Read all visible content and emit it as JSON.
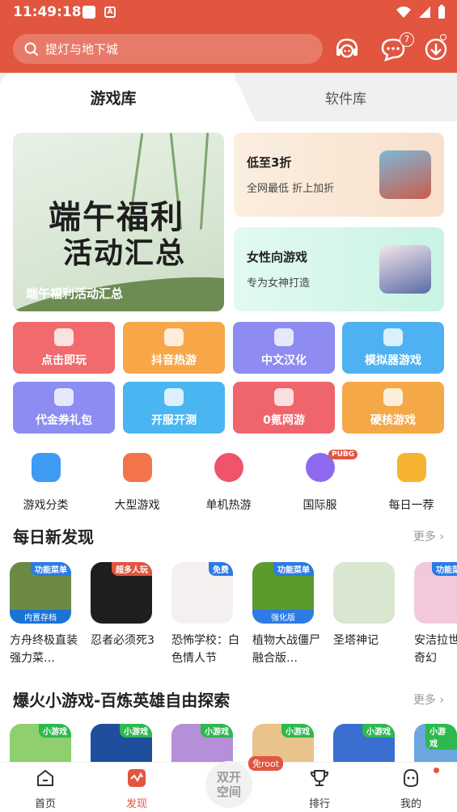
{
  "status": {
    "time": "11:49:18"
  },
  "header": {
    "search_placeholder": "提灯与地下城",
    "message_count": "7"
  },
  "tabs": [
    "游戏库",
    "软件库"
  ],
  "banner": {
    "art_line1": "端午福利",
    "art_line2": "活动汇总",
    "caption": "端午福利活动汇总"
  },
  "promo_cards": [
    {
      "title": "低至3折",
      "subtitle": "全网最低 折上加折",
      "color": "#FBE9D6"
    },
    {
      "title": "女性向游戏",
      "subtitle": "专为女神打造",
      "color": "#D7F6EA"
    }
  ],
  "grid_buttons": [
    {
      "label": "点击即玩",
      "color": "#F06A6E"
    },
    {
      "label": "抖音热游",
      "color": "#F7A748"
    },
    {
      "label": "中文汉化",
      "color": "#8E8CF0"
    },
    {
      "label": "模拟器游戏",
      "color": "#4EB2F2"
    },
    {
      "label": "代金券礼包",
      "color": "#8C8CF2"
    },
    {
      "label": "开服开测",
      "color": "#49B6F1"
    },
    {
      "label": "0氪网游",
      "color": "#F0656C"
    },
    {
      "label": "硬核游戏",
      "color": "#F5A847"
    }
  ],
  "quick_links": [
    {
      "label": "游戏分类",
      "icon": "category-icon",
      "color": "#3D9BF3"
    },
    {
      "label": "大型游戏",
      "icon": "gamepad-icon",
      "color": "#F3744A"
    },
    {
      "label": "单机热游",
      "icon": "pacman-icon",
      "color": "#F0536A"
    },
    {
      "label": "国际服",
      "icon": "globe-icon",
      "color": "#8E6AF0",
      "badge": "PUBG"
    },
    {
      "label": "每日一荐",
      "icon": "star-badge-icon",
      "color": "#F6B332"
    }
  ],
  "section1": {
    "title": "每日新发现",
    "more": "更多",
    "apps": [
      {
        "name": "方舟终极直装强力菜…",
        "tag": "功能菜单",
        "subtag": "内置存档",
        "tag_color": "#2d7be5",
        "color": "#6c8a43"
      },
      {
        "name": "忍者必须死3",
        "tag": "超多人玩",
        "tag_color": "#E2553F",
        "color": "#1e1e1e"
      },
      {
        "name": "恐怖学校：白色情人节",
        "tag": "免费",
        "tag_color": "#2d7be5",
        "color": "#f4f0f0"
      },
      {
        "name": "植物大战僵尸融合版…",
        "tag": "功能菜单",
        "subtag": "强化版",
        "tag_color": "#2d7be5",
        "color": "#5b9a2c"
      },
      {
        "name": "圣塔神记",
        "tag": "",
        "tag_color": "#2d7be5",
        "color": "#d9e6d0"
      },
      {
        "name": "安洁拉世界：奇幻",
        "tag": "功能菜单",
        "tag_color": "#2d7be5",
        "color": "#f3c8dd"
      }
    ]
  },
  "section2": {
    "title": "爆火小游戏-百炼英雄自由探索",
    "more": "更多",
    "apps": [
      {
        "tag": "小游戏",
        "color": "#8fcf6e"
      },
      {
        "tag": "小游戏",
        "color": "#1f4f9c"
      },
      {
        "tag": "小游戏",
        "color": "#b58fd8"
      },
      {
        "tag": "小游戏",
        "color": "#e8c48a"
      },
      {
        "tag": "小游戏",
        "color": "#3a6fd0"
      },
      {
        "tag": "小游戏",
        "color": "#6ca6e0"
      }
    ]
  },
  "bottom_nav": {
    "items": [
      {
        "label": "首页"
      },
      {
        "label": "发现"
      },
      {
        "label": "排行"
      },
      {
        "label": "我的"
      }
    ],
    "center_line1": "双开",
    "center_line2": "空间",
    "center_badge": "免root"
  }
}
